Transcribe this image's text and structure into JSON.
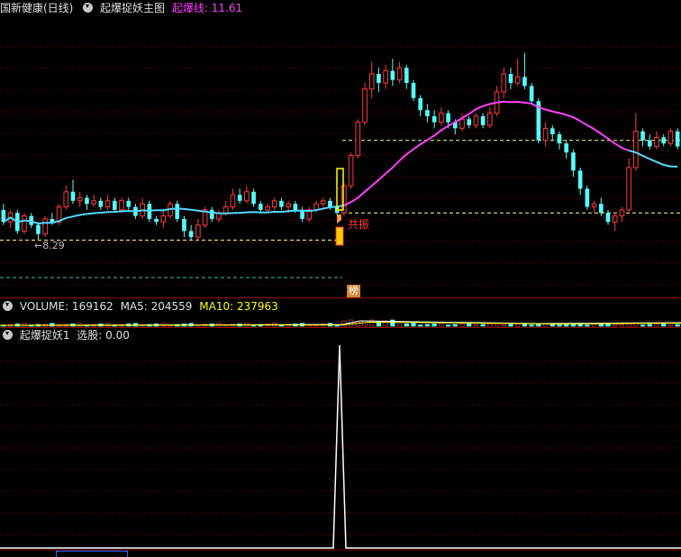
{
  "main": {
    "stock_title": "国新健康(日线)",
    "indicator_name": "起爆捉妖主图",
    "line_label": "起爆线: 11.61",
    "low_price_label": "←8.29",
    "signal_label": "共振",
    "badge_label": "榜"
  },
  "volume": {
    "label_volume": "VOLUME: 169162",
    "label_ma5": "MA5: 204559",
    "label_ma10": "MA10: 237963"
  },
  "indicator": {
    "label_name": "起爆捉妖1",
    "label_value": "选股: 0.00"
  },
  "colors": {
    "up": "#ff3c3c",
    "down": "#54ffff",
    "ma_before": "#54d8ff",
    "ma_after": "#ff40ff",
    "ma_tail": "#54d8ff",
    "grid": "#8b0000",
    "vol_ma5": "#ffffff",
    "vol_ma10": "#ffff00",
    "dashed": "#ffff88",
    "lower_dash": "#40c0c0"
  },
  "candles": [
    {
      "o": 9.3,
      "c": 8.9,
      "h": 9.5,
      "l": 8.8
    },
    {
      "o": 8.9,
      "c": 9.2,
      "h": 9.3,
      "l": 8.7
    },
    {
      "o": 9.2,
      "c": 8.6,
      "h": 9.3,
      "l": 8.5
    },
    {
      "o": 8.6,
      "c": 9.1,
      "h": 9.2,
      "l": 8.5
    },
    {
      "o": 9.1,
      "c": 8.8,
      "h": 9.2,
      "l": 8.7
    },
    {
      "o": 8.8,
      "c": 8.5,
      "h": 8.9,
      "l": 8.3
    },
    {
      "o": 8.5,
      "c": 9.0,
      "h": 9.1,
      "l": 8.4
    },
    {
      "o": 9.0,
      "c": 8.9,
      "h": 9.2,
      "l": 8.8
    },
    {
      "o": 8.9,
      "c": 9.4,
      "h": 9.5,
      "l": 8.8
    },
    {
      "o": 9.4,
      "c": 9.9,
      "h": 10.1,
      "l": 9.3
    },
    {
      "o": 9.9,
      "c": 9.6,
      "h": 10.3,
      "l": 9.5
    },
    {
      "o": 9.6,
      "c": 9.7,
      "h": 9.9,
      "l": 9.4
    },
    {
      "o": 9.7,
      "c": 9.5,
      "h": 9.8,
      "l": 9.3
    },
    {
      "o": 9.5,
      "c": 9.6,
      "h": 9.8,
      "l": 9.4
    },
    {
      "o": 9.6,
      "c": 9.4,
      "h": 9.7,
      "l": 9.3
    },
    {
      "o": 9.4,
      "c": 9.6,
      "h": 9.8,
      "l": 9.3
    },
    {
      "o": 9.6,
      "c": 9.3,
      "h": 9.7,
      "l": 9.2
    },
    {
      "o": 9.3,
      "c": 9.6,
      "h": 9.7,
      "l": 9.2
    },
    {
      "o": 9.6,
      "c": 9.4,
      "h": 9.7,
      "l": 9.3
    },
    {
      "o": 9.4,
      "c": 9.1,
      "h": 9.5,
      "l": 9.0
    },
    {
      "o": 9.1,
      "c": 9.5,
      "h": 9.7,
      "l": 9.0
    },
    {
      "o": 9.5,
      "c": 9.0,
      "h": 9.6,
      "l": 8.9
    },
    {
      "o": 9.0,
      "c": 8.9,
      "h": 9.1,
      "l": 8.8
    },
    {
      "o": 8.9,
      "c": 9.1,
      "h": 9.3,
      "l": 8.7
    },
    {
      "o": 9.1,
      "c": 9.5,
      "h": 9.6,
      "l": 9.0
    },
    {
      "o": 9.5,
      "c": 9.0,
      "h": 9.6,
      "l": 8.9
    },
    {
      "o": 9.0,
      "c": 8.6,
      "h": 9.1,
      "l": 8.4
    },
    {
      "o": 8.6,
      "c": 8.4,
      "h": 8.8,
      "l": 8.3
    },
    {
      "o": 8.4,
      "c": 8.8,
      "h": 9.0,
      "l": 8.3
    },
    {
      "o": 8.8,
      "c": 9.3,
      "h": 9.4,
      "l": 8.7
    },
    {
      "o": 9.3,
      "c": 9.0,
      "h": 9.4,
      "l": 8.9
    },
    {
      "o": 9.0,
      "c": 9.2,
      "h": 9.3,
      "l": 8.9
    },
    {
      "o": 9.2,
      "c": 9.4,
      "h": 9.6,
      "l": 9.1
    },
    {
      "o": 9.4,
      "c": 9.8,
      "h": 10.0,
      "l": 9.3
    },
    {
      "o": 9.8,
      "c": 9.6,
      "h": 10.0,
      "l": 9.5
    },
    {
      "o": 9.6,
      "c": 9.9,
      "h": 10.1,
      "l": 9.5
    },
    {
      "o": 9.9,
      "c": 9.5,
      "h": 10.0,
      "l": 9.4
    },
    {
      "o": 9.5,
      "c": 9.3,
      "h": 9.6,
      "l": 9.2
    },
    {
      "o": 9.3,
      "c": 9.4,
      "h": 9.5,
      "l": 9.2
    },
    {
      "o": 9.4,
      "c": 9.6,
      "h": 9.7,
      "l": 9.3
    },
    {
      "o": 9.6,
      "c": 9.4,
      "h": 9.7,
      "l": 9.3
    },
    {
      "o": 9.4,
      "c": 9.5,
      "h": 9.6,
      "l": 9.2
    },
    {
      "o": 9.5,
      "c": 9.3,
      "h": 9.6,
      "l": 9.2
    },
    {
      "o": 9.3,
      "c": 9.0,
      "h": 9.4,
      "l": 8.9
    },
    {
      "o": 9.0,
      "c": 9.3,
      "h": 9.4,
      "l": 8.9
    },
    {
      "o": 9.3,
      "c": 9.5,
      "h": 9.6,
      "l": 9.2
    },
    {
      "o": 9.5,
      "c": 9.6,
      "h": 9.7,
      "l": 9.4
    },
    {
      "o": 9.6,
      "c": 9.4,
      "h": 9.7,
      "l": 9.3
    },
    {
      "o": 9.4,
      "c": 9.2,
      "h": 9.5,
      "l": 9.1
    },
    {
      "o": 9.2,
      "c": 10.1,
      "h": 10.2,
      "l": 9.1
    },
    {
      "o": 10.1,
      "c": 11.1,
      "h": 11.2,
      "l": 10.0
    },
    {
      "o": 11.1,
      "c": 12.2,
      "h": 12.3,
      "l": 11.0
    },
    {
      "o": 12.2,
      "c": 13.3,
      "h": 13.5,
      "l": 12.1
    },
    {
      "o": 13.3,
      "c": 13.8,
      "h": 14.2,
      "l": 13.0
    },
    {
      "o": 13.8,
      "c": 13.5,
      "h": 14.0,
      "l": 13.2
    },
    {
      "o": 13.5,
      "c": 13.9,
      "h": 14.1,
      "l": 13.3
    },
    {
      "o": 13.9,
      "c": 13.6,
      "h": 14.3,
      "l": 13.4
    },
    {
      "o": 13.6,
      "c": 14.0,
      "h": 14.2,
      "l": 13.5
    },
    {
      "o": 14.0,
      "c": 13.5,
      "h": 14.1,
      "l": 13.3
    },
    {
      "o": 13.5,
      "c": 13.0,
      "h": 13.6,
      "l": 12.9
    },
    {
      "o": 13.0,
      "c": 12.6,
      "h": 13.1,
      "l": 12.4
    },
    {
      "o": 12.6,
      "c": 12.4,
      "h": 12.8,
      "l": 12.2
    },
    {
      "o": 12.4,
      "c": 12.2,
      "h": 12.6,
      "l": 12.0
    },
    {
      "o": 12.2,
      "c": 12.5,
      "h": 12.7,
      "l": 12.1
    },
    {
      "o": 12.5,
      "c": 12.2,
      "h": 12.6,
      "l": 12.0
    },
    {
      "o": 12.2,
      "c": 12.0,
      "h": 12.3,
      "l": 11.8
    },
    {
      "o": 12.0,
      "c": 12.3,
      "h": 12.5,
      "l": 11.9
    },
    {
      "o": 12.3,
      "c": 12.1,
      "h": 12.4,
      "l": 12.0
    },
    {
      "o": 12.1,
      "c": 12.4,
      "h": 12.5,
      "l": 12.0
    },
    {
      "o": 12.4,
      "c": 12.1,
      "h": 12.5,
      "l": 12.0
    },
    {
      "o": 12.1,
      "c": 12.5,
      "h": 12.7,
      "l": 12.0
    },
    {
      "o": 12.5,
      "c": 13.2,
      "h": 13.4,
      "l": 12.4
    },
    {
      "o": 13.2,
      "c": 13.8,
      "h": 14.0,
      "l": 13.0
    },
    {
      "o": 13.8,
      "c": 13.5,
      "h": 14.0,
      "l": 13.3
    },
    {
      "o": 13.5,
      "c": 13.7,
      "h": 14.3,
      "l": 13.4
    },
    {
      "o": 13.7,
      "c": 13.4,
      "h": 14.5,
      "l": 13.3
    },
    {
      "o": 13.4,
      "c": 12.9,
      "h": 13.5,
      "l": 12.8
    },
    {
      "o": 12.9,
      "c": 11.6,
      "h": 13.0,
      "l": 11.5
    },
    {
      "o": 11.6,
      "c": 12.0,
      "h": 12.2,
      "l": 11.4
    },
    {
      "o": 12.0,
      "c": 11.8,
      "h": 12.1,
      "l": 11.6
    },
    {
      "o": 11.8,
      "c": 11.5,
      "h": 11.9,
      "l": 11.3
    },
    {
      "o": 11.5,
      "c": 11.2,
      "h": 11.6,
      "l": 11.0
    },
    {
      "o": 11.2,
      "c": 10.6,
      "h": 11.3,
      "l": 10.4
    },
    {
      "o": 10.6,
      "c": 10.0,
      "h": 10.7,
      "l": 9.8
    },
    {
      "o": 10.0,
      "c": 9.4,
      "h": 10.1,
      "l": 9.3
    },
    {
      "o": 9.4,
      "c": 9.5,
      "h": 9.6,
      "l": 9.2
    },
    {
      "o": 9.5,
      "c": 9.2,
      "h": 9.7,
      "l": 9.1
    },
    {
      "o": 9.2,
      "c": 8.9,
      "h": 9.3,
      "l": 8.8
    },
    {
      "o": 8.9,
      "c": 9.1,
      "h": 9.2,
      "l": 8.6
    },
    {
      "o": 9.1,
      "c": 9.3,
      "h": 9.4,
      "l": 8.9
    },
    {
      "o": 9.3,
      "c": 10.7,
      "h": 11.0,
      "l": 9.2
    },
    {
      "o": 10.7,
      "c": 11.9,
      "h": 12.5,
      "l": 10.6
    },
    {
      "o": 11.9,
      "c": 11.6,
      "h": 12.0,
      "l": 11.4
    },
    {
      "o": 11.6,
      "c": 11.4,
      "h": 11.8,
      "l": 11.3
    },
    {
      "o": 11.4,
      "c": 11.7,
      "h": 11.9,
      "l": 11.3
    },
    {
      "o": 11.7,
      "c": 11.5,
      "h": 11.8,
      "l": 11.4
    },
    {
      "o": 11.5,
      "c": 11.9,
      "h": 12.0,
      "l": 11.4
    },
    {
      "o": 11.9,
      "c": 11.4,
      "h": 12.0,
      "l": 11.3
    }
  ]
}
